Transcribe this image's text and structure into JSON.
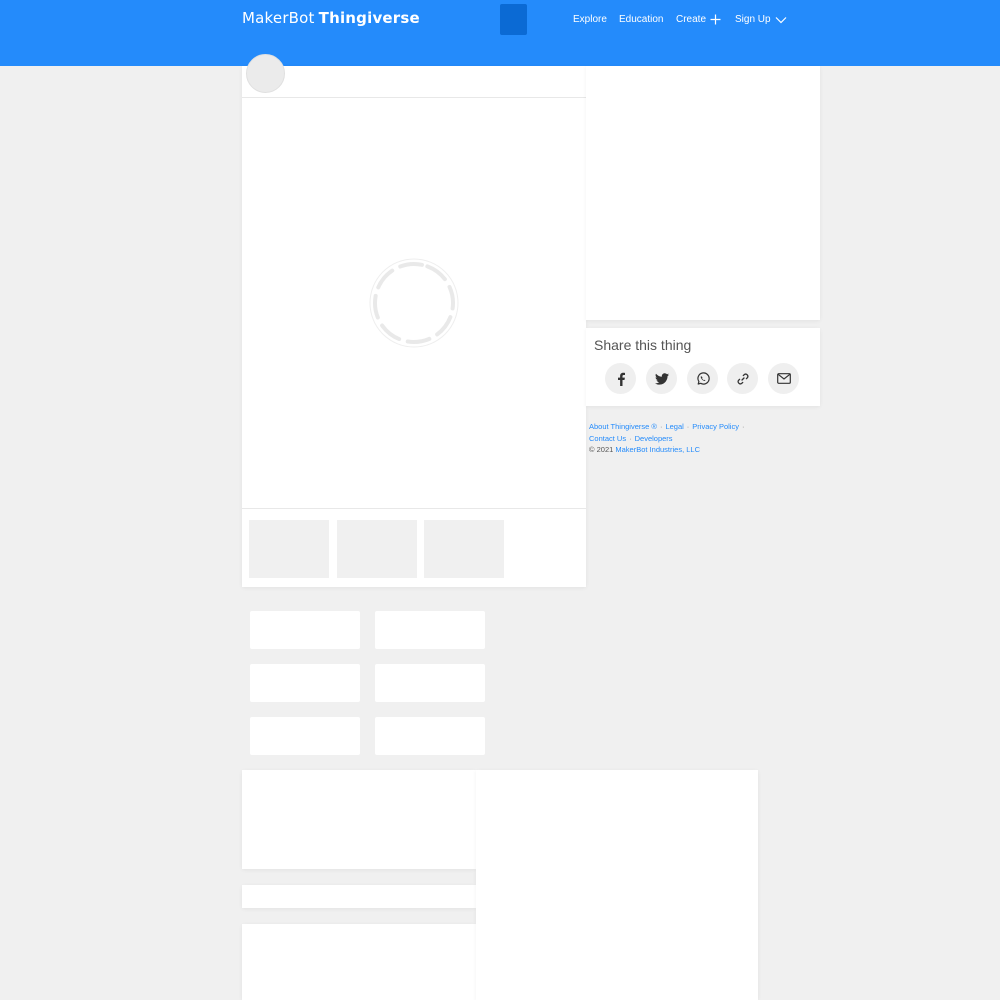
{
  "header": {
    "logo_brand": "MakerBot",
    "logo_product": "Thingiverse",
    "nav": {
      "explore": "Explore",
      "education": "Education",
      "create": "Create",
      "sign_up": "Sign Up"
    },
    "colors": {
      "bar": "#248bfb",
      "search_block": "#0b6ad4"
    }
  },
  "share": {
    "title": "Share this thing",
    "buttons": [
      {
        "icon": "facebook-icon"
      },
      {
        "icon": "twitter-icon"
      },
      {
        "icon": "whatsapp-icon"
      },
      {
        "icon": "link-icon"
      },
      {
        "icon": "email-icon"
      }
    ]
  },
  "footer": {
    "about": "About Thingiverse ®",
    "legal": "Legal",
    "privacy": "Privacy Policy",
    "contact": "Contact Us",
    "developers": "Developers",
    "copyright": "©  2021",
    "company": "MakerBot Industries, LLC",
    "separator": "·"
  }
}
